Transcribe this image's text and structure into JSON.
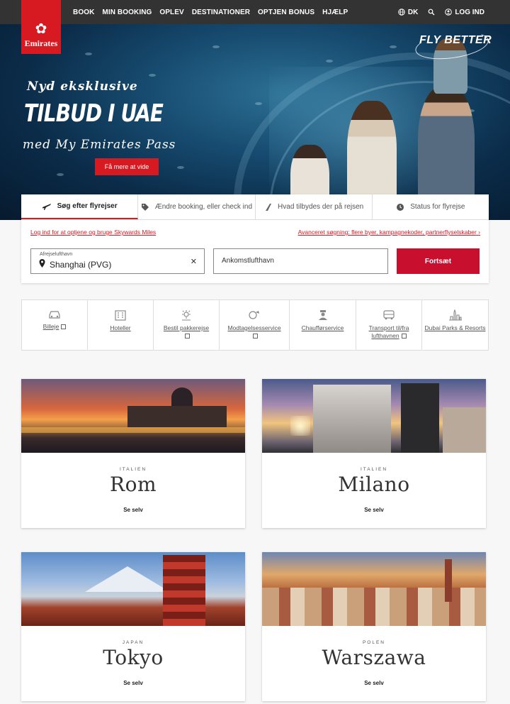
{
  "brand": {
    "name": "Emirates",
    "accent": "#d71921",
    "tagline": "FLY BETTER"
  },
  "nav": {
    "items": [
      "BOOK",
      "MIN BOOKING",
      "OPLEV",
      "DESTINATIONER",
      "OPTJEN BONUS",
      "HJÆLP"
    ],
    "region": "DK",
    "login": "LOG IND"
  },
  "hero": {
    "line1": "Nyd eksklusive",
    "line2": "TILBUD I UAE",
    "line3": "med My Emirates Pass",
    "cta": "Få mere at vide"
  },
  "booking": {
    "tabs": [
      "Søg efter flyrejser",
      "Ændre booking, eller check ind",
      "Hvad tilbydes der på rejsen",
      "Status for flyrejse"
    ],
    "skywards_link": "Log ind for at optjene og bruge Skywards Miles",
    "advanced_link": "Avanceret søgning: flere byer, kampagnekoder, partnerflyselskaber",
    "from_label": "Afrejselufthavn",
    "from_value": "Shanghai (PVG)",
    "to_placeholder": "Ankomstlufthavn",
    "continue": "Fortsæt"
  },
  "services": [
    {
      "label": "Billeje",
      "icon": "car-icon",
      "external": true
    },
    {
      "label": "Hoteller",
      "icon": "hotel-icon",
      "external": false
    },
    {
      "label": "Bestil pakkerejse",
      "icon": "package-icon",
      "external": true
    },
    {
      "label": "Modtagelsesservice",
      "icon": "meet-greet-icon",
      "external": true
    },
    {
      "label": "Chaufførservice",
      "icon": "chauffeur-icon",
      "external": false
    },
    {
      "label": "Transport til/fra lufthavnen",
      "icon": "bus-icon",
      "external": true
    },
    {
      "label": "Dubai Parks & Resorts",
      "icon": "skyline-icon",
      "external": false
    }
  ],
  "destinations": [
    {
      "country": "ITALIEN",
      "city": "Rom",
      "cta": "Se selv"
    },
    {
      "country": "ITALIEN",
      "city": "Milano",
      "cta": "Se selv"
    },
    {
      "country": "JAPAN",
      "city": "Tokyo",
      "cta": "Se selv"
    },
    {
      "country": "POLEN",
      "city": "Warszawa",
      "cta": "Se selv"
    }
  ]
}
